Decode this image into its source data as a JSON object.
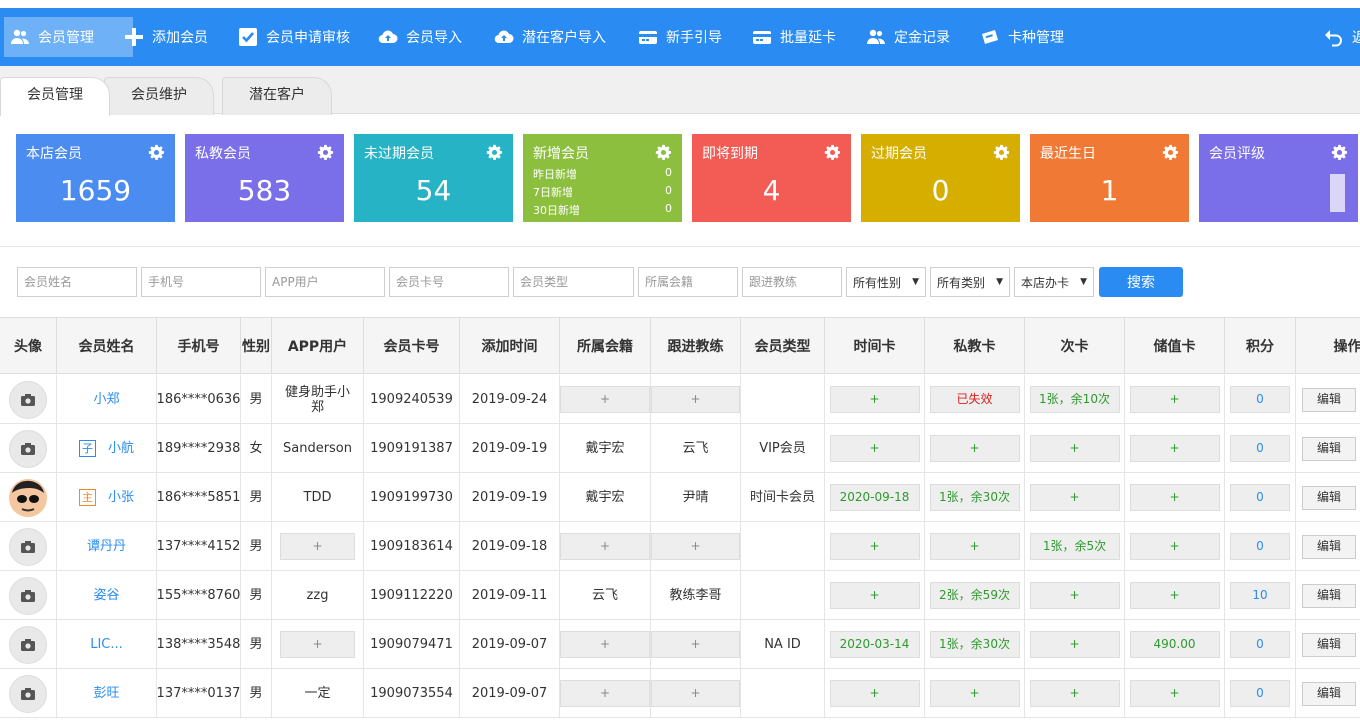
{
  "toolbar": {
    "items": [
      {
        "label": "会员管理",
        "icon": "users-icon"
      },
      {
        "label": "添加会员",
        "icon": "plus-icon"
      },
      {
        "label": "会员申请审核",
        "icon": "check-icon"
      },
      {
        "label": "会员导入",
        "icon": "cloud-upload-icon"
      },
      {
        "label": "潜在客户导入",
        "icon": "cloud-upload-icon"
      },
      {
        "label": "新手引导",
        "icon": "card-icon"
      },
      {
        "label": "批量延卡",
        "icon": "card-icon"
      },
      {
        "label": "定金记录",
        "icon": "users-icon"
      },
      {
        "label": "卡种管理",
        "icon": "ticket-icon"
      }
    ],
    "back_label": "返"
  },
  "tabs": [
    {
      "label": "会员管理"
    },
    {
      "label": "会员维护"
    },
    {
      "label": "潜在客户"
    }
  ],
  "cards": [
    {
      "title": "本店会员",
      "value": "1659",
      "color": "#4a8cf0"
    },
    {
      "title": "私教会员",
      "value": "583",
      "color": "#7b6ee9"
    },
    {
      "title": "未过期会员",
      "value": "54",
      "color": "#27b3c6"
    },
    {
      "title": "新增会员",
      "color": "#8dbf3f",
      "sub": [
        {
          "label": "昨日新增",
          "value": "0"
        },
        {
          "label": "7日新增",
          "value": "0"
        },
        {
          "label": "30日新增",
          "value": "0"
        }
      ]
    },
    {
      "title": "即将到期",
      "value": "4",
      "color": "#f25c54"
    },
    {
      "title": "过期会员",
      "value": "0",
      "color": "#d6ae00"
    },
    {
      "title": "最近生日",
      "value": "1",
      "color": "#f07a35"
    },
    {
      "title": "会员评级",
      "color": "#7b6ee9"
    }
  ],
  "filters": {
    "name": "会员姓名",
    "phone": "手机号",
    "app_user": "APP用户",
    "card_no": "会员卡号",
    "member_type": "会员类型",
    "club": "所属会籍",
    "coach": "跟进教练",
    "gender_select": "所有性别",
    "category_select": "所有类别",
    "store_select": "本店办卡",
    "search_label": "搜索"
  },
  "table": {
    "headers": [
      "头像",
      "会员姓名",
      "手机号",
      "性别",
      "APP用户",
      "会员卡号",
      "添加时间",
      "所属会籍",
      "跟进教练",
      "会员类型",
      "时间卡",
      "私教卡",
      "次卡",
      "储值卡",
      "积分",
      "操作"
    ],
    "edit_label": "编辑",
    "plus_label": "+",
    "rows": [
      {
        "badge": "",
        "name": "小郑",
        "phone": "186****0636",
        "gender": "男",
        "app": "健身助手小郑",
        "card": "1909240539",
        "date": "2019-09-24",
        "club": "",
        "coach": "",
        "type": "",
        "time_card": "",
        "pt_card": "已失效",
        "count_card": "1张，余10次",
        "value_card": "",
        "points": "0"
      },
      {
        "badge": "子",
        "name": "小航",
        "phone": "189****2938",
        "gender": "女",
        "app": "Sanderson",
        "card": "1909191387",
        "date": "2019-09-19",
        "club": "戴宇宏",
        "coach": "云飞",
        "type": "VIP会员",
        "time_card": "",
        "pt_card": "",
        "count_card": "",
        "value_card": "",
        "points": "0"
      },
      {
        "badge": "主",
        "name": "小张",
        "phone": "186****5851",
        "gender": "男",
        "app": "TDD",
        "card": "1909199730",
        "date": "2019-09-19",
        "club": "戴宇宏",
        "coach": "尹晴",
        "type": "时间卡会员",
        "time_card": "2020-09-18",
        "pt_card": "1张，余30次",
        "count_card": "",
        "value_card": "",
        "points": "0"
      },
      {
        "badge": "",
        "name": "谭丹丹",
        "phone": "137****4152",
        "gender": "男",
        "app": "",
        "card": "1909183614",
        "date": "2019-09-18",
        "club": "",
        "coach": "",
        "type": "",
        "time_card": "",
        "pt_card": "",
        "count_card": "1张，余5次",
        "value_card": "",
        "points": "0"
      },
      {
        "badge": "",
        "name": "姿谷",
        "phone": "155****8760",
        "gender": "男",
        "app": "zzg",
        "card": "1909112220",
        "date": "2019-09-11",
        "club": "云飞",
        "coach": "教练李哥",
        "type": "",
        "time_card": "",
        "pt_card": "2张，余59次",
        "count_card": "",
        "value_card": "",
        "points": "10"
      },
      {
        "badge": "",
        "name": "LIC...",
        "phone": "138****3548",
        "gender": "男",
        "app": "",
        "card": "1909079471",
        "date": "2019-09-07",
        "club": "",
        "coach": "",
        "type": "NA ID",
        "time_card": "2020-03-14",
        "pt_card": "1张，余30次",
        "count_card": "",
        "value_card": "490.00",
        "points": "0"
      },
      {
        "badge": "",
        "name": "彭旺",
        "phone": "137****0137",
        "gender": "男",
        "app": "一定",
        "card": "1909073554",
        "date": "2019-09-07",
        "club": "",
        "coach": "",
        "type": "",
        "time_card": "",
        "pt_card": "",
        "count_card": "",
        "value_card": "",
        "points": "0"
      }
    ]
  }
}
